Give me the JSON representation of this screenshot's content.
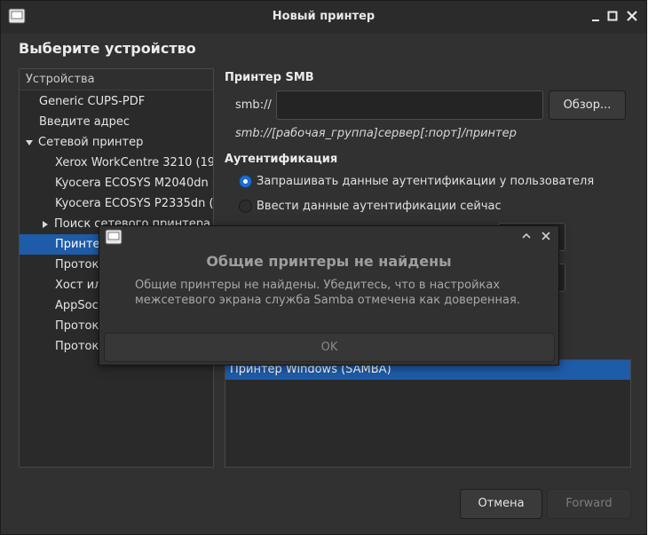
{
  "window": {
    "title": "Новый принтер",
    "heading": "Выберите устройство"
  },
  "devices": {
    "header": "Устройства",
    "items": [
      {
        "label": "Generic CUPS-PDF",
        "indent": 0,
        "expander": "",
        "selected": false
      },
      {
        "label": "Введите адрес",
        "indent": 0,
        "expander": "",
        "selected": false
      },
      {
        "label": "Сетевой принтер",
        "indent": 0,
        "expander": "down",
        "selected": false
      },
      {
        "label": "Xerox WorkCentre 3210 (19",
        "indent": 1,
        "expander": "",
        "selected": false
      },
      {
        "label": "Kyocera ECOSYS M2040dn (",
        "indent": 1,
        "expander": "",
        "selected": false
      },
      {
        "label": "Kyocera ECOSYS P2335dn (",
        "indent": 1,
        "expander": "",
        "selected": false
      },
      {
        "label": "Поиск сетевого принтера",
        "indent": 1,
        "expander": "right",
        "selected": false
      },
      {
        "label": "Принте",
        "indent": 1,
        "expander": "",
        "selected": true
      },
      {
        "label": "Протоко",
        "indent": 1,
        "expander": "",
        "selected": false
      },
      {
        "label": "Хост ил",
        "indent": 1,
        "expander": "",
        "selected": false
      },
      {
        "label": "AppSoc",
        "indent": 1,
        "expander": "",
        "selected": false
      },
      {
        "label": "Протоко",
        "indent": 1,
        "expander": "",
        "selected": false
      },
      {
        "label": "Протоко",
        "indent": 1,
        "expander": "",
        "selected": false
      }
    ]
  },
  "smb": {
    "section_title": "Принтер SMB",
    "prefix_label": "smb://",
    "url_value": "",
    "browse_label": "Обзор...",
    "format_hint": "smb://[рабочая_группа]сервер[:порт]/принтер"
  },
  "auth": {
    "section_title": "Аутентификация",
    "option_prompt": "Запрашивать данные аутентификации у пользователя",
    "option_now": "Ввести данные аутентификации сейчас",
    "selected": "prompt"
  },
  "connection": {
    "selected_label": "Принтер Windows (SAMBA)"
  },
  "dialog": {
    "title": "Общие принтеры не найдены",
    "message": "Общие принтеры не найдены. Убедитесь, что в настройках межсетевого экрана служба Samba отмечена как доверенная.",
    "ok_label": "OK"
  },
  "footer": {
    "cancel_label": "Отмена",
    "forward_label": "Forward"
  },
  "colors": {
    "accent": "#1e5ba8",
    "window_bg": "#313131"
  }
}
